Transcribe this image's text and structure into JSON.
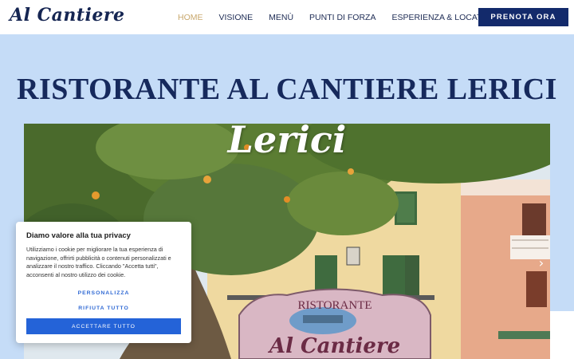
{
  "header": {
    "logo": "Al Cantiere",
    "nav": [
      {
        "label": "HOME",
        "active": true
      },
      {
        "label": "VISIONE",
        "active": false
      },
      {
        "label": "MENÙ",
        "active": false
      },
      {
        "label": "PUNTI DI FORZA",
        "active": false
      },
      {
        "label": "ESPERIENZA & LOCATION",
        "active": false
      }
    ],
    "cta": "PRENOTA ORA"
  },
  "hero": {
    "title": "RISTORANTE AL CANTIERE LERICI",
    "photo_script": "Lerici",
    "sign_top": "RISTORANTE",
    "sign_main": "Al Cantiere",
    "next_icon": "chevron-right-icon"
  },
  "cookie": {
    "title": "Diamo valore alla tua privacy",
    "text": "Utilizziamo i cookie per migliorare la tua esperienza di navigazione, offrirti pubblicità o contenuti personalizzati e analizzare il nostro traffico. Cliccando \"Accetta tutti\", acconsenti al nostro utilizzo dei cookie.",
    "customize": "PERSONALIZZA",
    "reject": "RIFIUTA TUTTO",
    "accept": "ACCETTARE TUTTO"
  },
  "colors": {
    "brand_navy": "#132a6b",
    "nav_active": "#c9a86d",
    "hero_bg": "#c5dcf7",
    "cookie_blue": "#2463d8"
  }
}
